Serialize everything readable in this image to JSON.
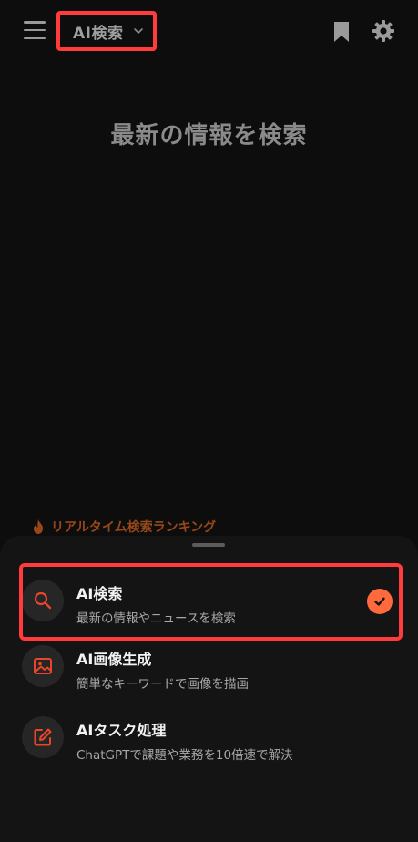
{
  "header": {
    "mode_label": "AI検索"
  },
  "hero": {
    "title": "最新の情報を検索"
  },
  "ranking": {
    "label": "リアルタイム検索ランキング"
  },
  "options": [
    {
      "title": "AI検索",
      "description": "最新の情報やニュースを検索",
      "icon": "search-icon",
      "selected": true
    },
    {
      "title": "AI画像生成",
      "description": "簡単なキーワードで画像を描画",
      "icon": "image-icon",
      "selected": false
    },
    {
      "title": "AIタスク処理",
      "description": "ChatGPTで課題や業務を10倍速で解決",
      "icon": "edit-icon",
      "selected": false
    }
  ],
  "colors": {
    "accent": "#ff6a3d",
    "highlight": "#ff3b3b",
    "icon_orange": "#e8452a"
  }
}
